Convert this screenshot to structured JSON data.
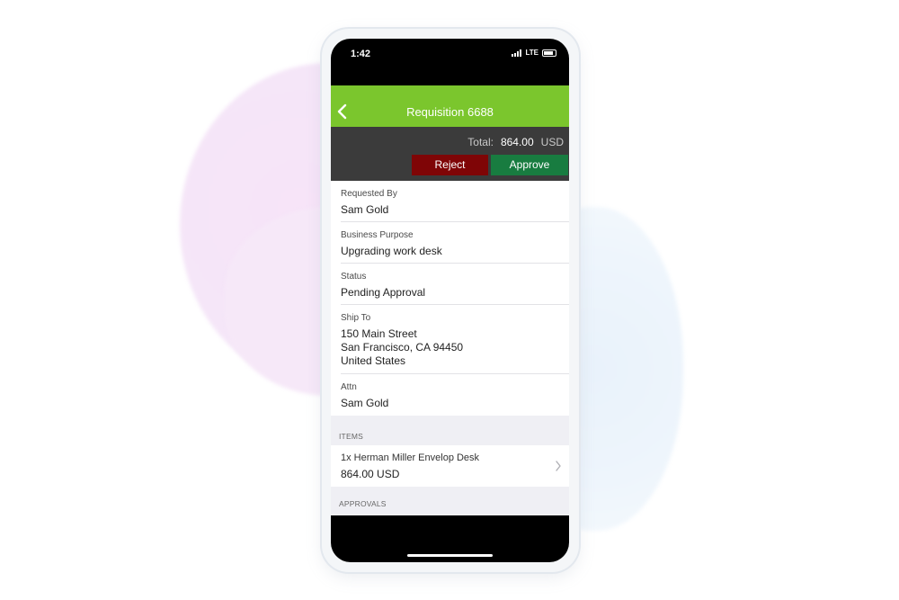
{
  "status_bar": {
    "time": "1:42",
    "network": "LTE"
  },
  "nav": {
    "title": "Requisition 6688"
  },
  "summary": {
    "total_label": "Total:",
    "total_value": "864.00",
    "currency": "USD"
  },
  "actions": {
    "reject_label": "Reject",
    "approve_label": "Approve"
  },
  "fields": [
    {
      "label": "Requested By",
      "value": "Sam Gold"
    },
    {
      "label": "Business Purpose",
      "value": "Upgrading work desk"
    },
    {
      "label": "Status",
      "value": "Pending Approval"
    },
    {
      "label": "Ship To",
      "value": "150 Main Street\nSan Francisco, CA 94450\nUnited States"
    },
    {
      "label": "Attn",
      "value": "Sam Gold"
    }
  ],
  "items_section": {
    "header": "ITEMS",
    "items": [
      {
        "name": "1x Herman Miller Envelop Desk",
        "price": "864.00 USD"
      }
    ]
  },
  "approvals_section": {
    "header": "APPROVALS"
  },
  "colors": {
    "nav": "#7bc62d",
    "reject": "#7f0506",
    "approve": "#187c40",
    "action_bar": "#3b3b3b"
  }
}
